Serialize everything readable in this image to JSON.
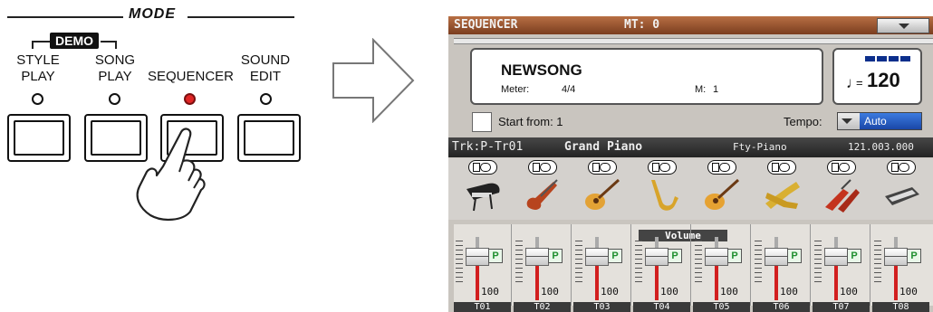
{
  "panel": {
    "mode_title": "MODE",
    "demo_label": "DEMO",
    "buttons": [
      {
        "line1": "STYLE",
        "line2": "PLAY",
        "led_on": false
      },
      {
        "line1": "SONG",
        "line2": "PLAY",
        "led_on": false
      },
      {
        "line1": "",
        "line2": "SEQUENCER",
        "led_on": true
      },
      {
        "line1": "SOUND",
        "line2": "EDIT",
        "led_on": false
      }
    ]
  },
  "screen": {
    "title": "SEQUENCER",
    "mt": "MT: 0",
    "song_name": "NEWSONG",
    "meter_label": "Meter:",
    "meter_value": "4/4",
    "measure_label": "M:",
    "measure_value": "1",
    "tempo_symbol": "♩",
    "tempo_eq": "=",
    "tempo_value": "120",
    "start_from_label": "Start from: 1",
    "tempo_label": "Tempo:",
    "tempo_mode": "Auto",
    "track_bar": {
      "track": "Trk:P-Tr01",
      "sound": "Grand Piano",
      "bank": "Fty-Piano",
      "position": "121.003.000"
    },
    "volume_header": "Volume",
    "play_button_label": "P",
    "tracks": [
      {
        "label": "T01",
        "volume": "100",
        "instrument": "grand-piano-icon"
      },
      {
        "label": "T02",
        "volume": "100",
        "instrument": "electric-guitar-icon"
      },
      {
        "label": "T03",
        "volume": "100",
        "instrument": "acoustic-guitar-icon"
      },
      {
        "label": "T04",
        "volume": "100",
        "instrument": "saxophone-icon"
      },
      {
        "label": "T05",
        "volume": "100",
        "instrument": "acoustic-guitar-icon"
      },
      {
        "label": "T06",
        "volume": "100",
        "instrument": "brass-icon"
      },
      {
        "label": "T07",
        "volume": "100",
        "instrument": "drums-icon"
      },
      {
        "label": "T08",
        "volume": "100",
        "instrument": "synth-icon"
      }
    ]
  }
}
